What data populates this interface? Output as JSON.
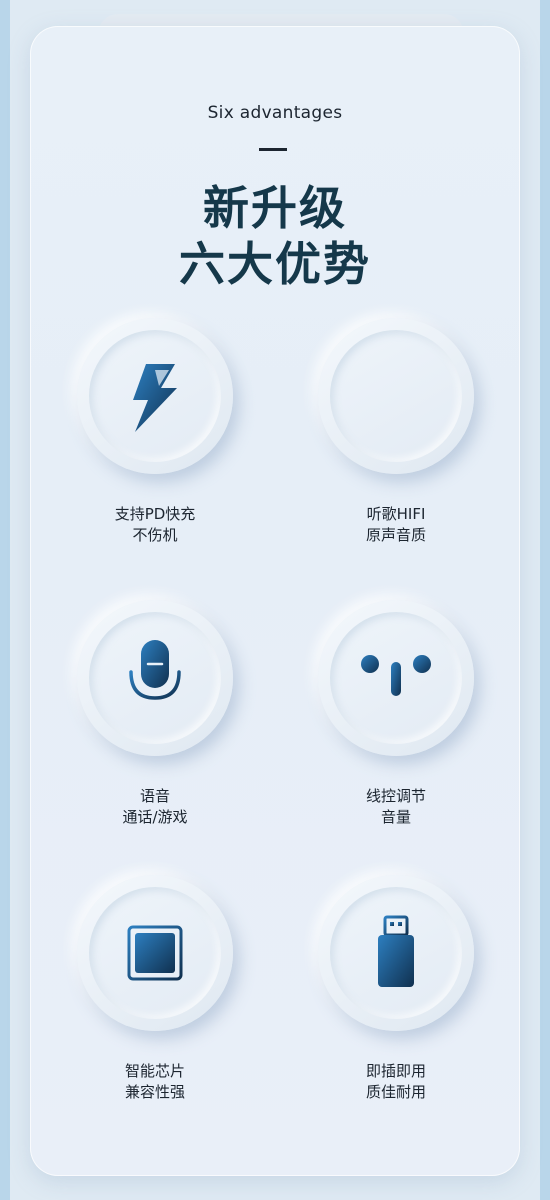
{
  "header": {
    "subtitle": "Six advantages",
    "title_line1": "新升级",
    "title_line2": "六大优势"
  },
  "features": [
    {
      "icon": "lightning-icon",
      "line1": "支持PD快充",
      "line2": "不伤机"
    },
    {
      "icon": "sound-wave-icon",
      "line1": "听歌HIFI",
      "line2": "原声音质"
    },
    {
      "icon": "microphone-icon",
      "line1": "语音",
      "line2": "通话/游戏"
    },
    {
      "icon": "earphones-icon",
      "line1": "线控调节",
      "line2": "音量"
    },
    {
      "icon": "chip-icon",
      "line1": "智能芯片",
      "line2": "兼容性强"
    },
    {
      "icon": "usb-drive-icon",
      "line1": "即插即用",
      "line2": "质佳耐用"
    }
  ],
  "colors": {
    "accent": "#15384a",
    "icon_gradient_start": "#2d7fc0",
    "icon_gradient_end": "#10304f",
    "background": "#e6eef7"
  }
}
